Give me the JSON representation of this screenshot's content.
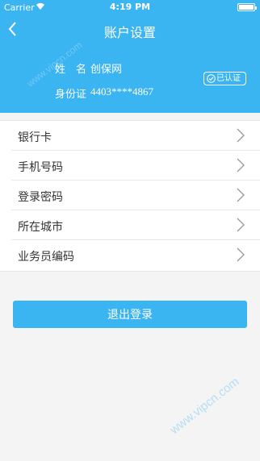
{
  "status_bar": {
    "carrier": "Carrier",
    "time": "4:19 PM"
  },
  "nav": {
    "title": "账户设置"
  },
  "profile": {
    "name_label": "姓　名",
    "name_value": "创保网",
    "id_label": "身份证",
    "id_value": "4403****4867",
    "verified_label": "已认证"
  },
  "settings_list": [
    {
      "label": "银行卡"
    },
    {
      "label": "手机号码"
    },
    {
      "label": "登录密码"
    },
    {
      "label": "所在城市"
    },
    {
      "label": "业务员编码"
    }
  ],
  "actions": {
    "logout_label": "退出登录"
  },
  "watermark": {
    "text": "www.vipcn.com"
  },
  "colors": {
    "accent": "#3bb4f2",
    "background": "#f4f4f4"
  }
}
